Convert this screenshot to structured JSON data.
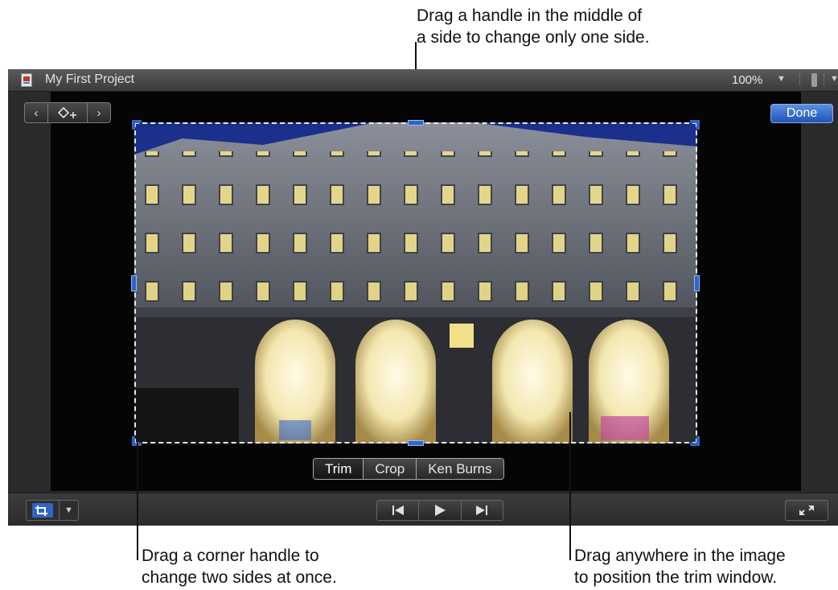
{
  "callouts": {
    "top": [
      "Drag a handle in the middle of",
      "a side to change only one side."
    ],
    "bottom_left": [
      "Drag a corner handle to",
      "change two sides at once."
    ],
    "bottom_right": [
      "Drag anywhere in the image",
      "to position the trim window."
    ]
  },
  "window": {
    "title": "My First Project",
    "zoom": "100%",
    "zoom_arrow": "▼",
    "view_arrow": "▼"
  },
  "nav": {
    "prev": "‹",
    "next": "›"
  },
  "done_label": "Done",
  "modes": [
    {
      "label": "Trim",
      "active": true
    },
    {
      "label": "Crop",
      "active": false
    },
    {
      "label": "Ken Burns",
      "active": false
    }
  ],
  "toolbar": {
    "crop_menu_arrow": "▼"
  },
  "icons": [
    "document-icon",
    "keyframe-add-icon",
    "crop-icon",
    "skip-back-icon",
    "play-icon",
    "skip-forward-icon",
    "fullscreen-icon"
  ],
  "colors": {
    "accent": "#2f64c8",
    "done_button": "#2b63c6",
    "viewer_bg": "#2a2a2a",
    "stage_bg": "#050505"
  }
}
